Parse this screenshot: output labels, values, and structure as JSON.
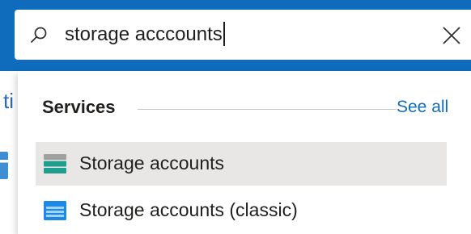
{
  "search": {
    "value": "storage acccounts"
  },
  "background": {
    "partial_text": "ti"
  },
  "dropdown": {
    "section_heading": "Services",
    "see_all_label": "See all",
    "results": [
      {
        "label": "Storage accounts",
        "icon": "storage-accounts-icon",
        "selected": true
      },
      {
        "label": "Storage accounts (classic)",
        "icon": "storage-accounts-classic-icon",
        "selected": false
      }
    ]
  },
  "colors": {
    "header": "#0f6cbd",
    "link": "#0f6cbd",
    "selected_row": "#e9e7e6",
    "storage_icon_teal": "#1f9e8e",
    "storage_classic_blue": "#1e88e5"
  }
}
